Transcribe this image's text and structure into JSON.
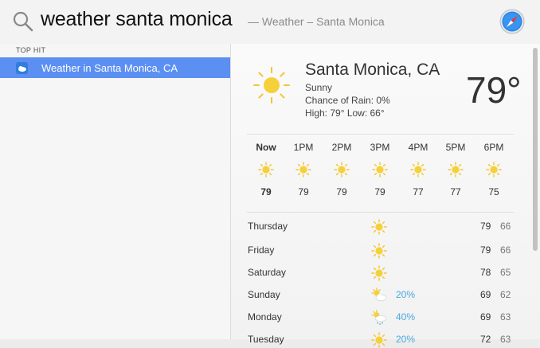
{
  "search": {
    "query": "weather santa monica",
    "suggestion": "— Weather – Santa Monica"
  },
  "results": {
    "section_label": "TOP HIT",
    "top_hit": "Weather in Santa Monica, CA"
  },
  "preview": {
    "location": "Santa Monica, CA",
    "condition": "Sunny",
    "rain": "Chance of Rain: 0%",
    "high_low": "High: 79°  Low: 66°",
    "current_temp": "79°",
    "hourly": [
      {
        "label": "Now",
        "icon": "sun-icon",
        "temp": "79"
      },
      {
        "label": "1PM",
        "icon": "sun-icon",
        "temp": "79"
      },
      {
        "label": "2PM",
        "icon": "sun-icon",
        "temp": "79"
      },
      {
        "label": "3PM",
        "icon": "sun-icon",
        "temp": "79"
      },
      {
        "label": "4PM",
        "icon": "sun-icon",
        "temp": "77"
      },
      {
        "label": "5PM",
        "icon": "sun-icon",
        "temp": "77"
      },
      {
        "label": "6PM",
        "icon": "sun-icon",
        "temp": "75"
      }
    ],
    "daily": [
      {
        "day": "Thursday",
        "icon": "sun-icon",
        "pct": "",
        "high": "79",
        "low": "66"
      },
      {
        "day": "Friday",
        "icon": "sun-icon",
        "pct": "",
        "high": "79",
        "low": "66"
      },
      {
        "day": "Saturday",
        "icon": "sun-icon",
        "pct": "",
        "high": "78",
        "low": "65"
      },
      {
        "day": "Sunday",
        "icon": "partly-cloudy-icon",
        "pct": "20%",
        "high": "69",
        "low": "62"
      },
      {
        "day": "Monday",
        "icon": "cloud-drizzle-icon",
        "pct": "40%",
        "high": "69",
        "low": "63"
      },
      {
        "day": "Tuesday",
        "icon": "sun-icon",
        "pct": "20%",
        "high": "72",
        "low": "63"
      }
    ]
  },
  "colors": {
    "selection": "#5b8ff2",
    "sun": "#f3c531",
    "precip": "#4aa8de"
  }
}
